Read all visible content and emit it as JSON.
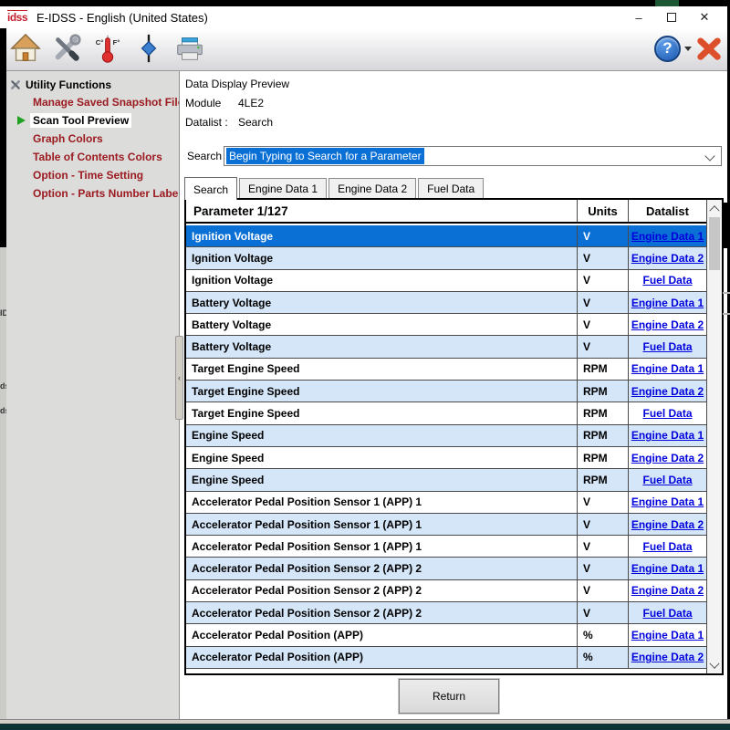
{
  "window": {
    "logo": "idss",
    "title": "E-IDSS - English (United States)",
    "controls": {
      "minimize": "–",
      "close": "✕"
    }
  },
  "toolbar": {
    "thermometer_labels": {
      "c": "C°",
      "f": "F°"
    },
    "help_label": "?"
  },
  "sidebar": {
    "root_label": "Utility Functions",
    "collapse_glyph": "‹",
    "items": [
      {
        "label": "Manage Saved Snapshot Files",
        "selected": false
      },
      {
        "label": "Scan Tool Preview",
        "selected": true
      },
      {
        "label": "Graph Colors",
        "selected": false
      },
      {
        "label": "Table of Contents Colors",
        "selected": false
      },
      {
        "label": "Option - Time Setting",
        "selected": false
      },
      {
        "label": "Option - Parts Number Label Pr",
        "selected": false
      }
    ]
  },
  "main": {
    "heading": "Data Display Preview",
    "module": {
      "label": "Module",
      "value": "4LE2"
    },
    "datalist": {
      "label": "Datalist :",
      "value": "Search"
    },
    "search": {
      "label": "Search",
      "value": "Begin Typing to Search for a Parameter"
    },
    "tabs": [
      {
        "label": "Search",
        "active": true
      },
      {
        "label": "Engine Data 1",
        "active": false
      },
      {
        "label": "Engine Data 2",
        "active": false
      },
      {
        "label": "Fuel Data",
        "active": false
      }
    ],
    "table": {
      "headers": [
        "Parameter 1/127",
        "Units",
        "Datalist"
      ],
      "selected_row_index": 0,
      "rows": [
        {
          "parameter": "Ignition Voltage",
          "units": "V",
          "datalist": "Engine Data 1"
        },
        {
          "parameter": "Ignition Voltage",
          "units": "V",
          "datalist": "Engine Data 2"
        },
        {
          "parameter": "Ignition Voltage",
          "units": "V",
          "datalist": "Fuel Data"
        },
        {
          "parameter": "Battery Voltage",
          "units": "V",
          "datalist": "Engine Data 1"
        },
        {
          "parameter": "Battery Voltage",
          "units": "V",
          "datalist": "Engine Data 2"
        },
        {
          "parameter": "Battery Voltage",
          "units": "V",
          "datalist": "Fuel Data"
        },
        {
          "parameter": "Target Engine Speed",
          "units": "RPM",
          "datalist": "Engine Data 1"
        },
        {
          "parameter": "Target Engine Speed",
          "units": "RPM",
          "datalist": "Engine Data 2"
        },
        {
          "parameter": "Target Engine Speed",
          "units": "RPM",
          "datalist": "Fuel Data"
        },
        {
          "parameter": "Engine Speed",
          "units": "RPM",
          "datalist": "Engine Data 1"
        },
        {
          "parameter": "Engine Speed",
          "units": "RPM",
          "datalist": "Engine Data 2"
        },
        {
          "parameter": "Engine Speed",
          "units": "RPM",
          "datalist": "Fuel Data"
        },
        {
          "parameter": "Accelerator Pedal Position Sensor 1 (APP) 1",
          "units": "V",
          "datalist": "Engine Data 1"
        },
        {
          "parameter": "Accelerator Pedal Position Sensor 1 (APP) 1",
          "units": "V",
          "datalist": "Engine Data 2"
        },
        {
          "parameter": "Accelerator Pedal Position Sensor 1 (APP) 1",
          "units": "V",
          "datalist": "Fuel Data"
        },
        {
          "parameter": "Accelerator Pedal Position Sensor 2 (APP) 2",
          "units": "V",
          "datalist": "Engine Data 1"
        },
        {
          "parameter": "Accelerator Pedal Position Sensor 2 (APP) 2",
          "units": "V",
          "datalist": "Engine Data 2"
        },
        {
          "parameter": "Accelerator Pedal Position Sensor 2 (APP) 2",
          "units": "V",
          "datalist": "Fuel Data"
        },
        {
          "parameter": "Accelerator Pedal Position (APP)",
          "units": "%",
          "datalist": "Engine Data 1"
        },
        {
          "parameter": "Accelerator Pedal Position (APP)",
          "units": "%",
          "datalist": "Engine Data 2"
        }
      ]
    },
    "return_label": "Return"
  },
  "artifacts": {
    "left_edge_fragments": [
      "ID",
      "ds",
      "ds"
    ]
  },
  "colors": {
    "selection_blue": "#0a70d6",
    "row_alt_blue": "#d4e6f8",
    "link_blue": "#0000dd",
    "sidebar_red": "#9b1b21",
    "sidebar_bg": "#dcdcda"
  }
}
